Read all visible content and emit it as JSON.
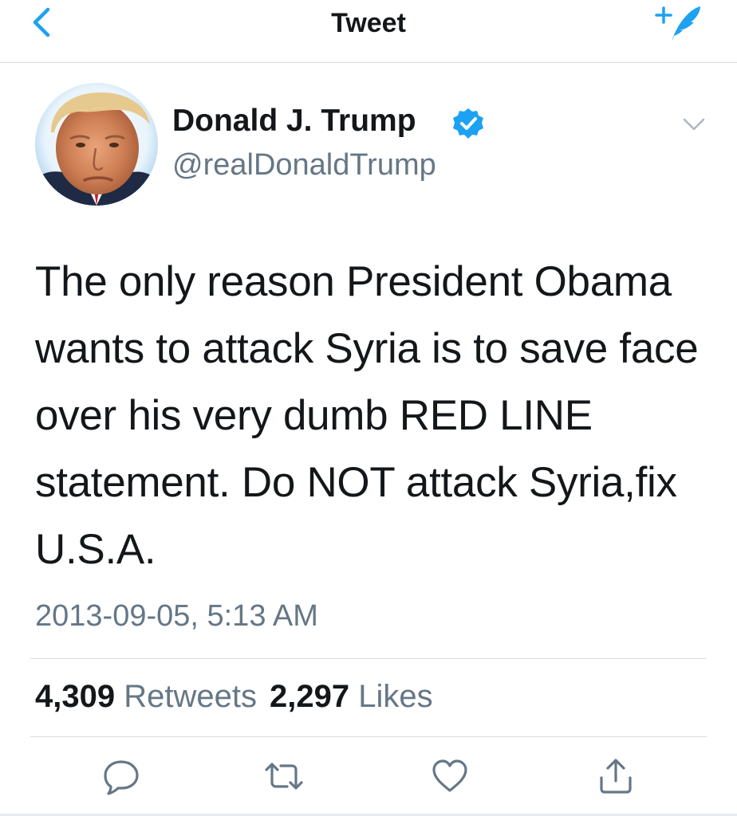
{
  "header": {
    "title": "Tweet",
    "back_icon": "chevron-left-icon",
    "compose_icon": "compose-tweet-icon",
    "accent_color": "#1da1f2"
  },
  "author": {
    "name": "Donald J. Trump",
    "handle": "@realDonaldTrump",
    "verified": true,
    "verified_icon": "verified-badge-icon"
  },
  "tweet": {
    "text": "The only reason President Obama wants to attack Syria is to save face over his very dumb RED LINE statement. Do NOT attack Syria,fix U.S.A.",
    "timestamp": "2013-09-05, 5:13 AM"
  },
  "stats": {
    "retweets_count": "4,309",
    "retweets_label": "Retweets",
    "likes_count": "2,297",
    "likes_label": "Likes"
  },
  "actions": [
    {
      "icon": "reply-icon"
    },
    {
      "icon": "retweet-icon"
    },
    {
      "icon": "like-icon"
    },
    {
      "icon": "share-icon"
    }
  ]
}
